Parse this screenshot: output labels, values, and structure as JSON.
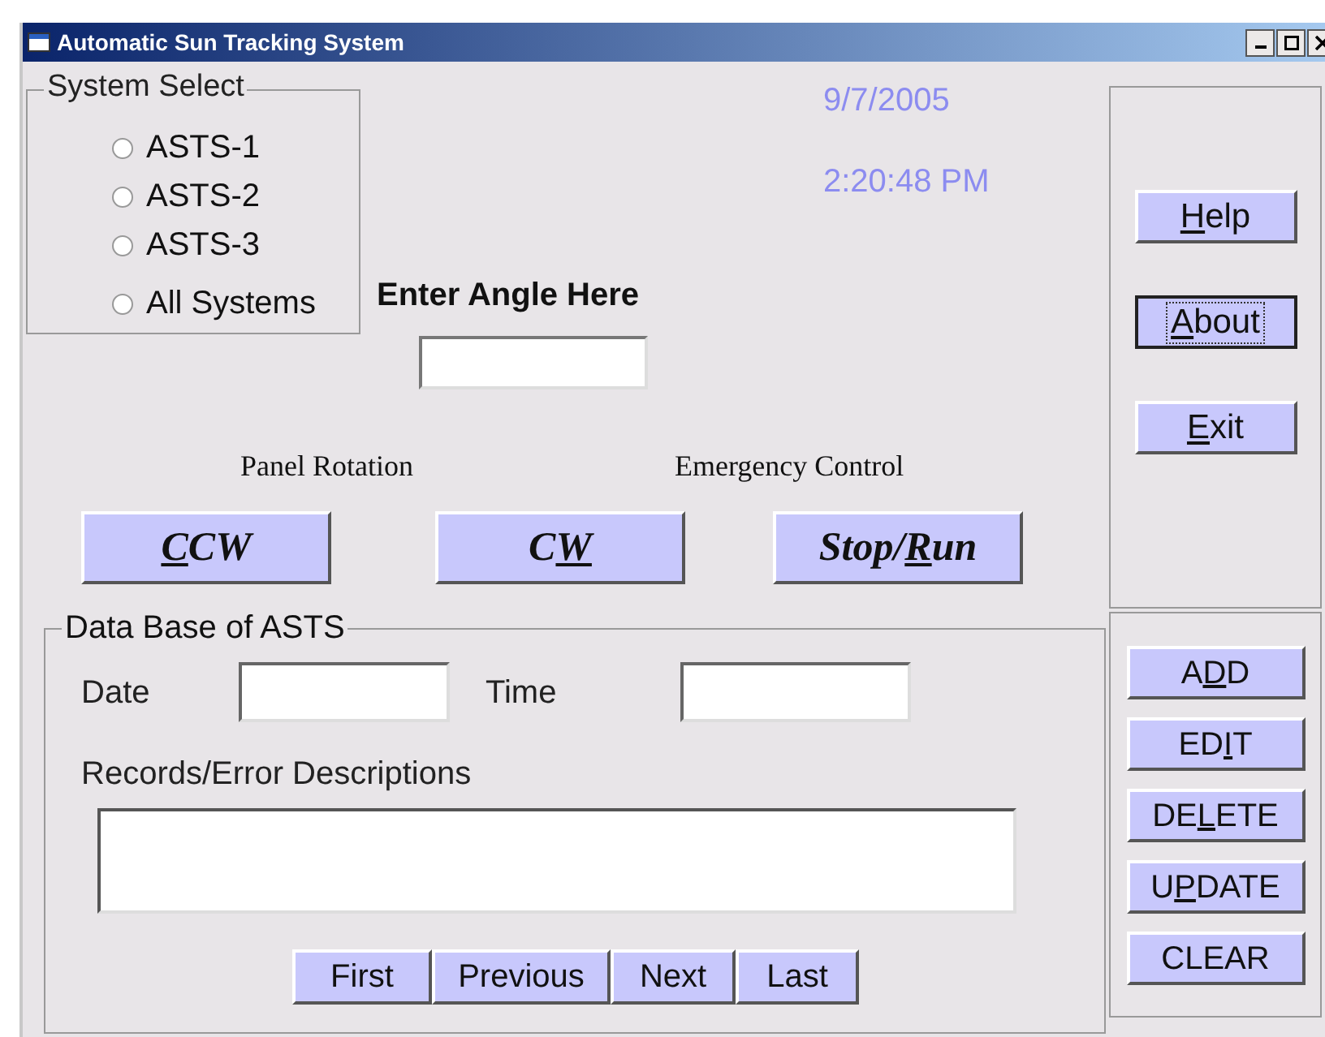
{
  "window": {
    "title": "Automatic Sun Tracking System"
  },
  "system_select": {
    "title": "System Select",
    "options": [
      {
        "label": "ASTS-1",
        "selected": false
      },
      {
        "label": "ASTS-2",
        "selected": false
      },
      {
        "label": "ASTS-3",
        "selected": false
      },
      {
        "label": "All Systems",
        "selected": false
      }
    ]
  },
  "clock": {
    "date": "9/7/2005",
    "time": "2:20:48 PM"
  },
  "angle": {
    "label": "Enter Angle Here"
  },
  "side_buttons": [
    {
      "key": "H",
      "after": "elp",
      "focused": false
    },
    {
      "key": "A",
      "after": "bout",
      "focused": true
    },
    {
      "key": "E",
      "after": "xit",
      "focused": false
    }
  ],
  "panel_rotation": {
    "label": "Panel Rotation"
  },
  "emergency_control": {
    "label": "Emergency Control"
  },
  "control_buttons": [
    {
      "key": "C",
      "after": "CW"
    },
    {
      "before": "C",
      "key": "W"
    },
    {
      "before": "Stop/",
      "key": "R",
      "after": "un"
    }
  ],
  "database": {
    "title": "Data Base of ASTS",
    "date_label": "Date",
    "time_label": "Time",
    "records_label": "Records/Error Descriptions",
    "nav_buttons": [
      "First",
      "Previous",
      "Next",
      "Last"
    ]
  },
  "record_buttons": [
    {
      "before": "A",
      "key": "D",
      "after": "D"
    },
    {
      "before": "ED",
      "key": "I",
      "after": "T"
    },
    {
      "before": "DE",
      "key": "L",
      "after": "ETE"
    },
    {
      "before": "U",
      "key": "P",
      "after": "DATE"
    },
    {
      "before": "CLEAR"
    }
  ]
}
